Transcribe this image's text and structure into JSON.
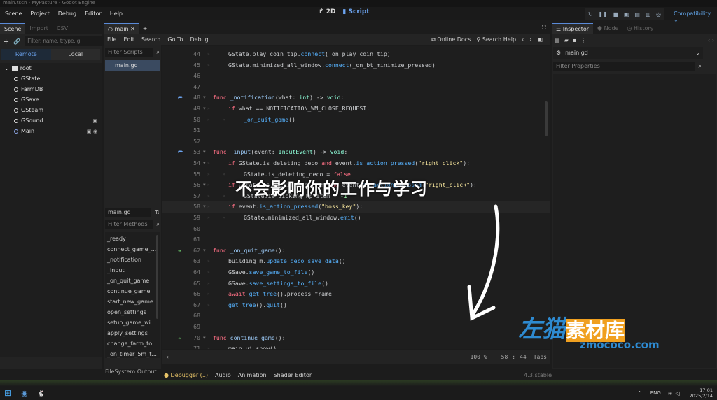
{
  "window": {
    "title": "main.tscn - MyPasture - Godot Engine"
  },
  "menu": [
    "Scene",
    "Project",
    "Debug",
    "Editor",
    "Help"
  ],
  "modes": {
    "2d": "2D",
    "script": "Script"
  },
  "renderer": "Compatibility",
  "scene_panel": {
    "tabs": [
      "Scene",
      "Import",
      "CSV"
    ],
    "filter_placeholder": "Filter: name, t:type, g",
    "remote": "Remote",
    "local": "Local",
    "nodes": [
      {
        "name": "root"
      },
      {
        "name": "GState"
      },
      {
        "name": "FarmDB"
      },
      {
        "name": "GSave"
      },
      {
        "name": "GSteam"
      },
      {
        "name": "GSound"
      },
      {
        "name": "Main"
      }
    ]
  },
  "script_tab": "main",
  "scripts": {
    "filter_placeholder": "Filter Scripts",
    "items": [
      "main.gd"
    ],
    "current": "main.gd",
    "methods_placeholder": "Filter Methods",
    "methods": [
      "_ready",
      "connect_game_...",
      "_notification",
      "_input",
      "_on_quit_game",
      "continue_game",
      "start_new_game",
      "open_settings",
      "setup_game_wi...",
      "apply_settings",
      "change_farm_to",
      "_on_timer_5m_t..."
    ]
  },
  "editor_menu": [
    "File",
    "Edit",
    "Search",
    "Go To",
    "Debug"
  ],
  "editor_tools": {
    "docs": "Online Docs",
    "help": "Search Help"
  },
  "code": [
    {
      "n": "44",
      "i": 1,
      "t": [
        [
          "pl",
          "GState.play_coin_tip."
        ],
        [
          "fn",
          "connect"
        ],
        [
          "pl",
          "(_on_play_coin_tip)"
        ]
      ]
    },
    {
      "n": "45",
      "i": 1,
      "t": [
        [
          "pl",
          "GState.minimized_all_window."
        ],
        [
          "fn",
          "connect"
        ],
        [
          "pl",
          "(_on_bt_minimize_pressed)"
        ]
      ]
    },
    {
      "n": "46",
      "i": 0,
      "t": []
    },
    {
      "n": "47",
      "i": 0,
      "t": []
    },
    {
      "n": "48",
      "i": 0,
      "g": "override",
      "f": true,
      "t": [
        [
          "kw",
          "func "
        ],
        [
          "id",
          "_notification"
        ],
        [
          "pl",
          "(what: "
        ],
        [
          "ty",
          "int"
        ],
        [
          "pl",
          ") -> "
        ],
        [
          "ty",
          "void"
        ],
        [
          "pl",
          ":"
        ]
      ]
    },
    {
      "n": "49",
      "i": 1,
      "f": true,
      "t": [
        [
          "kw",
          "if "
        ],
        [
          "pl",
          "what == NOTIFICATION_WM_CLOSE_REQUEST:"
        ]
      ]
    },
    {
      "n": "50",
      "i": 2,
      "t": [
        [
          "fn",
          "_on_quit_game"
        ],
        [
          "pl",
          "()"
        ]
      ]
    },
    {
      "n": "51",
      "i": 0,
      "t": []
    },
    {
      "n": "52",
      "i": 0,
      "t": []
    },
    {
      "n": "53",
      "i": 0,
      "g": "override",
      "f": true,
      "t": [
        [
          "kw",
          "func "
        ],
        [
          "id",
          "_input"
        ],
        [
          "pl",
          "(event: "
        ],
        [
          "ty",
          "InputEvent"
        ],
        [
          "pl",
          ") -> "
        ],
        [
          "ty",
          "void"
        ],
        [
          "pl",
          ":"
        ]
      ]
    },
    {
      "n": "54",
      "i": 1,
      "f": true,
      "t": [
        [
          "kw",
          "if "
        ],
        [
          "pl",
          "GState.is_deleting_deco "
        ],
        [
          "kw",
          "and "
        ],
        [
          "pl",
          "event."
        ],
        [
          "fn",
          "is_action_pressed"
        ],
        [
          "pl",
          "("
        ],
        [
          "str",
          "\"right_click\""
        ],
        [
          "pl",
          "):"
        ]
      ]
    },
    {
      "n": "55",
      "i": 2,
      "t": [
        [
          "pl",
          "GState.is_deleting_deco = "
        ],
        [
          "kw",
          "false"
        ]
      ]
    },
    {
      "n": "56",
      "i": 1,
      "f": true,
      "t": [
        [
          "kw",
          "if "
        ],
        [
          "pl",
          "GState.is_picking_hp_item "
        ],
        [
          "kw",
          "and "
        ],
        [
          "pl",
          "event."
        ],
        [
          "fn",
          "is_action_pressed"
        ],
        [
          "pl",
          "("
        ],
        [
          "str",
          "\"right_click\""
        ],
        [
          "pl",
          "):"
        ]
      ]
    },
    {
      "n": "57",
      "i": 2,
      "t": [
        [
          "pl",
          "GState.is_picking_hp_item = "
        ],
        [
          "nm",
          "-1"
        ]
      ]
    },
    {
      "n": "58",
      "i": 1,
      "f": true,
      "cur": true,
      "t": [
        [
          "kw",
          "if "
        ],
        [
          "pl",
          "event."
        ],
        [
          "fn",
          "is_action_pressed"
        ],
        [
          "pl",
          "("
        ],
        [
          "str",
          "\"boss_key\""
        ],
        [
          "pl",
          "):"
        ]
      ]
    },
    {
      "n": "59",
      "i": 2,
      "t": [
        [
          "pl",
          "GState.minimized_all_window."
        ],
        [
          "fn",
          "emit"
        ],
        [
          "pl",
          "()"
        ]
      ]
    },
    {
      "n": "60",
      "i": 0,
      "t": []
    },
    {
      "n": "61",
      "i": 0,
      "t": []
    },
    {
      "n": "62",
      "i": 0,
      "g": "signal",
      "f": true,
      "t": [
        [
          "kw",
          "func "
        ],
        [
          "id",
          "_on_quit_game"
        ],
        [
          "pl",
          "():"
        ]
      ]
    },
    {
      "n": "63",
      "i": 1,
      "t": [
        [
          "pl",
          "building_m."
        ],
        [
          "fn",
          "update_deco_save_data"
        ],
        [
          "pl",
          "()"
        ]
      ]
    },
    {
      "n": "64",
      "i": 1,
      "t": [
        [
          "pl",
          "GSave."
        ],
        [
          "fn",
          "save_game_to_file"
        ],
        [
          "pl",
          "()"
        ]
      ]
    },
    {
      "n": "65",
      "i": 1,
      "t": [
        [
          "pl",
          "GSave."
        ],
        [
          "fn",
          "save_settings_to_file"
        ],
        [
          "pl",
          "()"
        ]
      ]
    },
    {
      "n": "66",
      "i": 1,
      "t": [
        [
          "kw",
          "await "
        ],
        [
          "fn",
          "get_tree"
        ],
        [
          "pl",
          "().process_frame"
        ]
      ]
    },
    {
      "n": "67",
      "i": 1,
      "t": [
        [
          "fn",
          "get_tree"
        ],
        [
          "pl",
          "()."
        ],
        [
          "fn",
          "quit"
        ],
        [
          "pl",
          "()"
        ]
      ]
    },
    {
      "n": "68",
      "i": 0,
      "t": []
    },
    {
      "n": "69",
      "i": 0,
      "t": []
    },
    {
      "n": "70",
      "i": 0,
      "g": "signal",
      "f": true,
      "t": [
        [
          "kw",
          "func "
        ],
        [
          "id",
          "continue_game"
        ],
        [
          "pl",
          "():"
        ]
      ]
    },
    {
      "n": "71",
      "i": 1,
      "t": [
        [
          "pl",
          "main_ui.show()"
        ]
      ]
    }
  ],
  "status": {
    "zoom": "100 %",
    "line": "58",
    "col": "44",
    "indent": "Tabs"
  },
  "inspector": {
    "tabs": [
      "Inspector",
      "Node",
      "History"
    ],
    "object": "main.gd",
    "filter_placeholder": "Filter Properties"
  },
  "bottom_tabs": [
    "Debugger (1)",
    "Audio",
    "Animation",
    "Shader Editor"
  ],
  "filesystem_tab": "FileSystem",
  "output_tab": "Output",
  "version": "4.3.stable",
  "overlay_caption": "不会影响你的工作与学习",
  "watermark": {
    "text": "左猫素材库",
    "url": "zmococo.com"
  },
  "taskbar": {
    "lang": "ENG",
    "time": "17:01",
    "date": "2025/2/14"
  },
  "colors": {
    "accent": "#6ca4f0",
    "keyword": "#ff7085",
    "function": "#57b3ff",
    "string": "#ffeda1",
    "type": "#8effda"
  }
}
